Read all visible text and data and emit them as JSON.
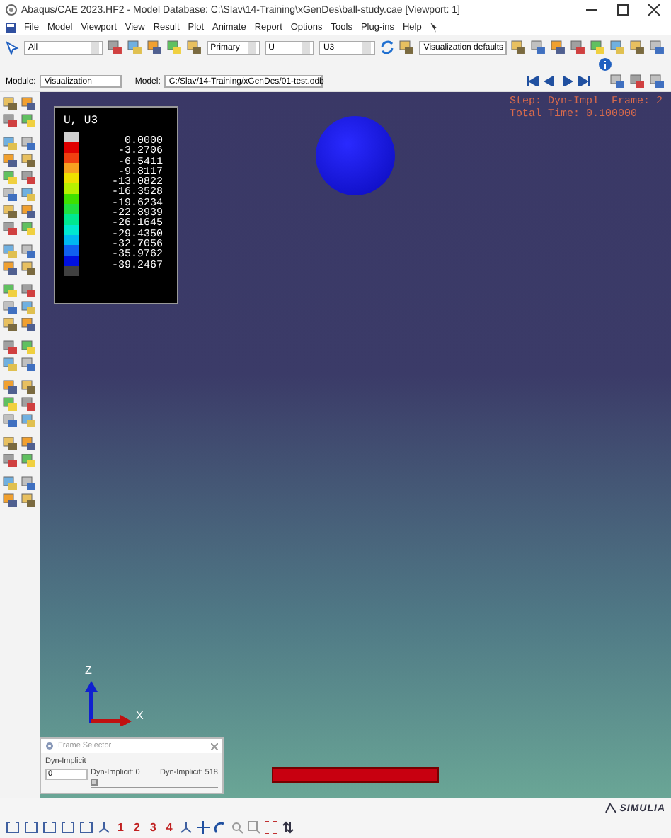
{
  "window": {
    "title": "Abaqus/CAE 2023.HF2 - Model Database: C:\\Slav\\14-Training\\xGenDes\\ball-study.cae [Viewport: 1]"
  },
  "menu": [
    "File",
    "Model",
    "Viewport",
    "View",
    "Result",
    "Plot",
    "Animate",
    "Report",
    "Options",
    "Tools",
    "Plug-ins",
    "Help"
  ],
  "toolbar": {
    "selection": "All",
    "step_type": "Primary",
    "variable": "U",
    "component": "U3",
    "defaults": "Visualization defaults"
  },
  "context_bar": {
    "module_label": "Module:",
    "module": "Visualization",
    "model_label": "Model:",
    "model": "C:/Slav/14-Training/xGenDes/01-test.odb"
  },
  "viewport": {
    "legend": {
      "title": "U, U3",
      "bands": [
        {
          "color": "#d0d0d0"
        },
        {
          "color": "#e00000"
        },
        {
          "color": "#f04010"
        },
        {
          "color": "#f8a020"
        },
        {
          "color": "#f0e000"
        },
        {
          "color": "#b8f000"
        },
        {
          "color": "#40e000"
        },
        {
          "color": "#20e040"
        },
        {
          "color": "#00e890"
        },
        {
          "color": "#00e8d0"
        },
        {
          "color": "#00b8f0"
        },
        {
          "color": "#1060f0"
        },
        {
          "color": "#0010e0"
        },
        {
          "color": "#404040"
        }
      ],
      "values": [
        "0.0000",
        "-3.2706",
        "-6.5411",
        "-9.8117",
        "-13.0822",
        "-16.3528",
        "-19.6234",
        "-22.8939",
        "-26.1645",
        "-29.4350",
        "-32.7056",
        "-35.9762",
        "-39.2467"
      ]
    },
    "state_block": [
      "Step: Dyn-Impl  Frame: 2",
      "Total Time: 0.100000"
    ],
    "triad": {
      "z": "Z",
      "x": "X"
    }
  },
  "frame_selector": {
    "title": "Frame Selector",
    "step": "Dyn-Implicit",
    "value": "0",
    "min_label": "Dyn-Implicit: 0",
    "max_label": "Dyn-Implicit: 518",
    "level": 0
  },
  "view_buttons": [
    "1",
    "2",
    "3",
    "4"
  ],
  "brand": "SIMULIA"
}
